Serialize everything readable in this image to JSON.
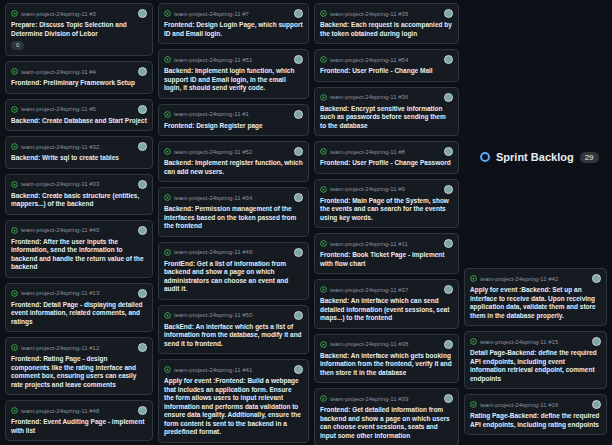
{
  "columns": [
    {
      "cards": [
        {
          "repo": "team-project-24spring-11 #3",
          "title": "Prepare: Discuss Topic Selection and Determine Division of Lebor",
          "badge": "0"
        },
        {
          "repo": "team-project-24spring-11 #4",
          "title": "Frontend: Preliminary Framework Setup"
        },
        {
          "repo": "team-project-24spring-11 #5",
          "title": "Backend: Create Database and Start Project"
        },
        {
          "repo": "team-project-24spring-11 #32",
          "title": "Backend: Write sql to create tables"
        },
        {
          "repo": "team-project-24spring-11 #33",
          "title": "Backend: Create basic structure (entities, mappers...) of the backend"
        },
        {
          "repo": "team-project-24spring-11 #40",
          "title": "Frontend: After the user inputs the information, send the information to backend and handle the return value of the backend"
        },
        {
          "repo": "team-project-24spring-11 #13",
          "title": "Frontend: Detail Page - displaying detailed event information, related comments, and ratings"
        },
        {
          "repo": "team-project-24spring-11 #12",
          "title": "Frontend: Rating Page - design components like the rating interface and comment box, ensuring users can easily rate projects and leave comments"
        },
        {
          "repo": "team-project-24spring-11 #48",
          "title": "Frontend: Event Auditing Page - implement with list"
        }
      ]
    },
    {
      "cards": [
        {
          "repo": "team-project-24spring-11 #7",
          "title": "Frontend: Design Login Page, which support ID and Email login."
        },
        {
          "repo": "team-project-24spring-11 #51",
          "title": "Backend: Implement login function, which support ID and Email login, in the email login, it should send verify code."
        },
        {
          "repo": "team-project-24spring-11 #1",
          "title": "Frontend: Design Register page"
        },
        {
          "repo": "team-project-24spring-11 #52",
          "title": "Backend: Implement register function, which can add new users."
        },
        {
          "repo": "team-project-24spring-11 #34",
          "title": "Backend: Permission management of the interfaces based on the token passed from the frontend"
        },
        {
          "repo": "team-project-24spring-11 #49",
          "title": "FrontEnd: Get a list of information from backend and show a page on which administrators can choose an event and audit it."
        },
        {
          "repo": "team-project-24spring-11 #50",
          "title": "BackEnd: An interface which gets a list of information from the database, modify it and send it to frontend."
        },
        {
          "repo": "team-project-24spring-11 #41",
          "title": "Apply for event :Frontend: Build a webpage that includes an application form. Ensure the form allows users to input relevant information and performs data validation to ensure data legality. Additionally, ensure the form content is sent to the backend in a predefined format."
        }
      ]
    },
    {
      "cards": [
        {
          "repo": "team-project-24spring-11 #35",
          "title": "Backend: Each request is accompanied by the token obtained during login"
        },
        {
          "repo": "team-project-24spring-11 #54",
          "title": "Frontend: User Profile - Change Mail"
        },
        {
          "repo": "team-project-24spring-11 #36",
          "title": "Backend: Encrypt sensitive information such as passwords before sending them to the database"
        },
        {
          "repo": "team-project-24spring-11 #8",
          "title": "Frontend: User Profile - Change Password"
        },
        {
          "repo": "team-project-24spring-11 #9",
          "title": "Frontend: Main Page of the System, show the events and can search for the events using key words."
        },
        {
          "repo": "team-project-24spring-11 #11",
          "title": "Frontend: Book Ticket Page - implement with flow chart"
        },
        {
          "repo": "team-project-24spring-11 #37",
          "title": "Backend: An interface which can send detailed information (event sessions, seat maps...) to the frontend"
        },
        {
          "repo": "team-project-24spring-11 #38",
          "title": "Backend: An interface which gets booking information from the frontend, verify it and then store it in the database"
        },
        {
          "repo": "team-project-24spring-11 #39",
          "title": "Frontend: Get detailed information from backend and show a page on which users can choose event sessions, seats and input some other information"
        }
      ]
    },
    {
      "title": "Sprint Backlog",
      "count": "29",
      "cards": [
        {
          "repo": "team-project-24spring-11 #42",
          "title": "Apply for event :Backend: Set up an interface to receive data. Upon receiving application data, validate them and store them in the database properly."
        },
        {
          "repo": "team-project-24spring-11 #15",
          "title": "Detail Page-Backend: define the required API endpoints, including event information retrieval endpoint, comment endpoints"
        },
        {
          "repo": "team-project-24spring-11 #16",
          "title": "Rating Page-Backend: define the required API endpoints, including rating endpoints"
        }
      ]
    }
  ]
}
